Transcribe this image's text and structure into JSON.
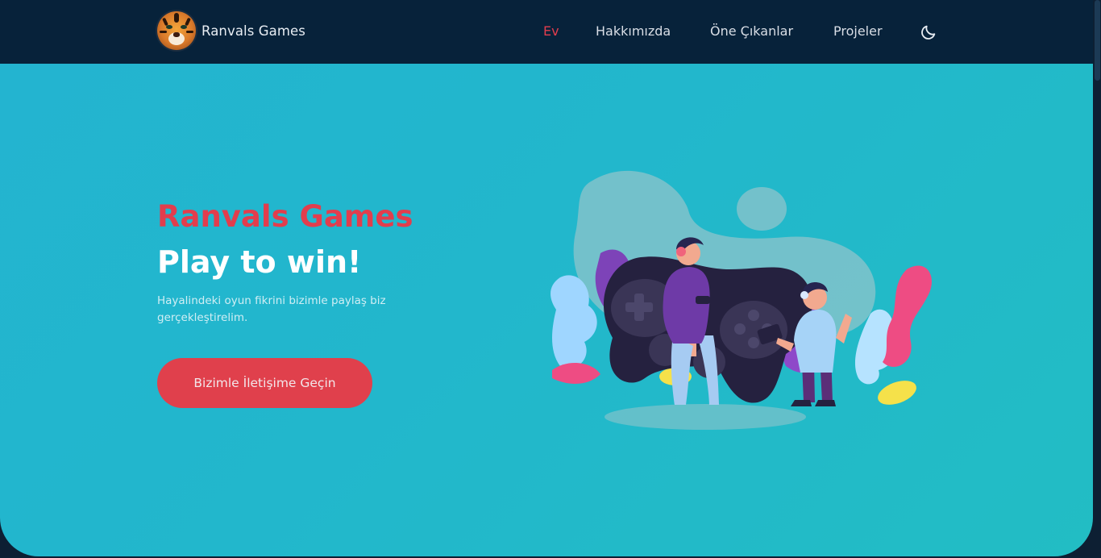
{
  "brand": {
    "name": "Ranvals Games",
    "logo_icon": "tiger-logo-icon"
  },
  "nav": {
    "items": [
      {
        "label": "Ev",
        "active": true
      },
      {
        "label": "Hakkımızda",
        "active": false
      },
      {
        "label": "Öne Çıkanlar",
        "active": false
      },
      {
        "label": "Projeler",
        "active": false
      }
    ],
    "theme_toggle_icon": "moon-icon"
  },
  "hero": {
    "title": "Ranvals Games",
    "subtitle": "Play to win!",
    "description": "Hayalindeki oyun fikrini bizimle paylaş biz gerçekleştirelim.",
    "cta_label": "Bizimle İletişime Geçin",
    "illustration_icon": "gamers-with-controller-illustration"
  },
  "colors": {
    "navbar": "#07223a",
    "accent": "#e23d4d",
    "hero_gradient_start": "#23b4d0",
    "hero_gradient_end": "#22bdc4",
    "button": "#e0404c"
  }
}
